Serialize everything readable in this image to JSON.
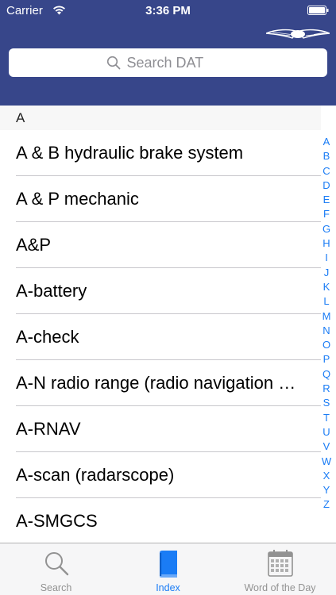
{
  "status_bar": {
    "carrier": "Carrier",
    "time": "3:36 PM"
  },
  "header": {
    "logo": "asa-wings-logo",
    "search": {
      "placeholder": "Search DAT",
      "value": ""
    }
  },
  "section": {
    "title": "A"
  },
  "terms": [
    "A & B hydraulic brake system",
    "A & P mechanic",
    "A&P",
    "A-battery",
    "A-check",
    "A-N radio range (radio navigation aid)",
    "A-RNAV",
    "A-scan (radarscope)",
    "A-SMGCS"
  ],
  "index_letters": [
    "A",
    "B",
    "C",
    "D",
    "E",
    "F",
    "G",
    "H",
    "I",
    "J",
    "K",
    "L",
    "M",
    "N",
    "O",
    "P",
    "Q",
    "R",
    "S",
    "T",
    "U",
    "V",
    "W",
    "X",
    "Y",
    "Z"
  ],
  "tabs": [
    {
      "label": "Search",
      "icon": "magnifier-icon",
      "active": false
    },
    {
      "label": "Index",
      "icon": "book-icon",
      "active": true
    },
    {
      "label": "Word of the Day",
      "icon": "calendar-icon",
      "active": false
    }
  ],
  "colors": {
    "header": "#37468a",
    "accent": "#1a7cf5",
    "inactive_tab": "#929292"
  }
}
